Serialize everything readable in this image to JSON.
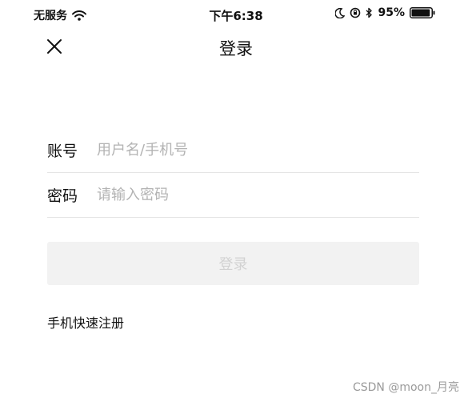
{
  "status_bar": {
    "carrier": "无服务",
    "time": "下午6:38",
    "battery_percent": "95%",
    "battery_level": 0.95,
    "icons": [
      "wifi-icon",
      "moon-icon",
      "orientation-lock-icon",
      "bluetooth-icon",
      "battery-icon"
    ]
  },
  "nav": {
    "title": "登录",
    "close_icon": "close-icon"
  },
  "form": {
    "account_label": "账号",
    "account_value": "",
    "account_placeholder": "用户名/手机号",
    "password_label": "密码",
    "password_value": "",
    "password_placeholder": "请输入密码"
  },
  "login_button": {
    "label": "登录",
    "enabled": false
  },
  "quick_register": {
    "label": "手机快速注册"
  },
  "watermark": {
    "text": "CSDN @moon_月亮"
  },
  "colors": {
    "text": "#111111",
    "placeholder": "#b3b3b3",
    "divider": "#e5e5e5",
    "button_bg_disabled": "#f2f2f2",
    "button_text_disabled": "#d2d2d2",
    "watermark": "#9a9a9a"
  }
}
